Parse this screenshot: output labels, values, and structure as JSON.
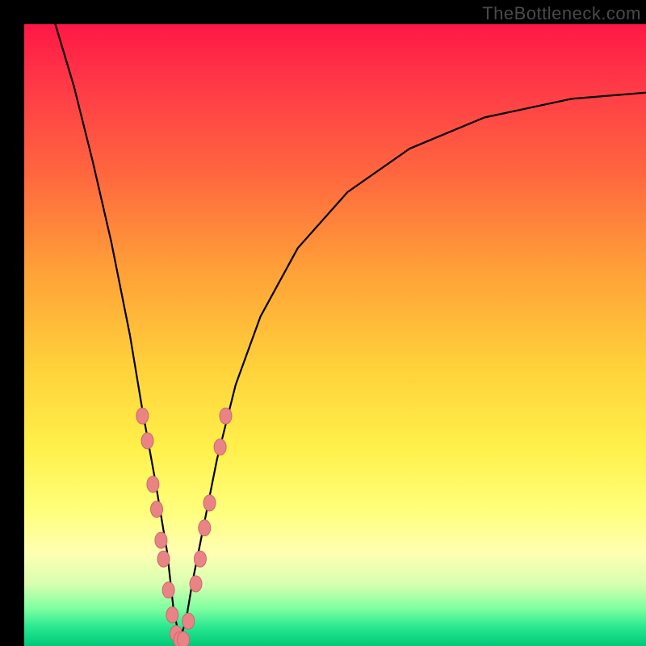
{
  "watermark": "TheBottleneck.com",
  "colors": {
    "gradient_top": "#ff1846",
    "gradient_bottom": "#00c878",
    "curve": "#000000",
    "marker_fill": "#e98385",
    "marker_stroke": "#c86a6c",
    "frame": "#000000"
  },
  "chart_data": {
    "type": "line",
    "title": "",
    "xlabel": "",
    "ylabel": "",
    "xlim": [
      0,
      100
    ],
    "ylim": [
      0,
      100
    ],
    "grid": false,
    "legend": null,
    "note": "V-shaped bottleneck curve; high y = high bottleneck (red), low y = low bottleneck (green). Minimum near x ≈ 25. Markers cluster along the lower portion of both arms of the V.",
    "series": [
      {
        "name": "bottleneck-curve",
        "x": [
          5,
          8,
          11,
          14,
          17,
          19,
          21,
          23,
          24,
          25,
          26,
          27,
          29,
          31,
          34,
          38,
          44,
          52,
          62,
          74,
          88,
          100
        ],
        "y": [
          100,
          90,
          78,
          65,
          50,
          38,
          27,
          15,
          6,
          1,
          4,
          10,
          20,
          30,
          42,
          53,
          64,
          73,
          80,
          85,
          88,
          89
        ]
      }
    ],
    "markers": {
      "name": "data-points",
      "points": [
        {
          "x": 19.0,
          "y": 37
        },
        {
          "x": 19.8,
          "y": 33
        },
        {
          "x": 20.7,
          "y": 26
        },
        {
          "x": 21.3,
          "y": 22
        },
        {
          "x": 22.0,
          "y": 17
        },
        {
          "x": 22.4,
          "y": 14
        },
        {
          "x": 23.2,
          "y": 9
        },
        {
          "x": 23.8,
          "y": 5
        },
        {
          "x": 24.4,
          "y": 2
        },
        {
          "x": 25.0,
          "y": 1
        },
        {
          "x": 25.6,
          "y": 1
        },
        {
          "x": 26.4,
          "y": 4
        },
        {
          "x": 27.6,
          "y": 10
        },
        {
          "x": 28.3,
          "y": 14
        },
        {
          "x": 29.0,
          "y": 19
        },
        {
          "x": 29.8,
          "y": 23
        },
        {
          "x": 31.5,
          "y": 32
        },
        {
          "x": 32.4,
          "y": 37
        }
      ]
    }
  }
}
